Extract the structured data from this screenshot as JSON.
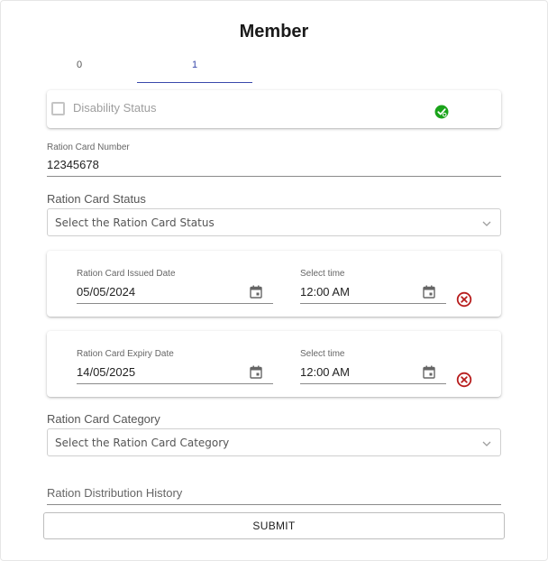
{
  "form": {
    "title": "Member"
  },
  "tabs": [
    {
      "label": "0"
    },
    {
      "label": "1"
    }
  ],
  "disability": {
    "label": "Disability Status",
    "checked": false,
    "icon": "verified-badge-icon",
    "icon_color": "#1aa31a"
  },
  "ration_card_number": {
    "label": "Ration Card Number",
    "value": "12345678"
  },
  "ration_card_status": {
    "label": "Ration Card Status",
    "placeholder": "Select the Ration Card Status"
  },
  "issued": {
    "date_label": "Ration Card Issued Date",
    "date_value": "05/05/2024",
    "time_label": "Select time",
    "time_value": "12:00 AM"
  },
  "expiry": {
    "date_label": "Ration Card Expiry Date",
    "date_value": "14/05/2025",
    "time_label": "Select time",
    "time_value": "12:00 AM"
  },
  "ration_card_category": {
    "label": "Ration Card Category",
    "placeholder": "Select the Ration Card Category"
  },
  "distribution_history": {
    "label": "Ration Distribution History"
  },
  "submit": {
    "label": "SUBMIT"
  },
  "colors": {
    "accent": "#3949ab",
    "danger": "#b71c1c",
    "success": "#1aa31a"
  }
}
